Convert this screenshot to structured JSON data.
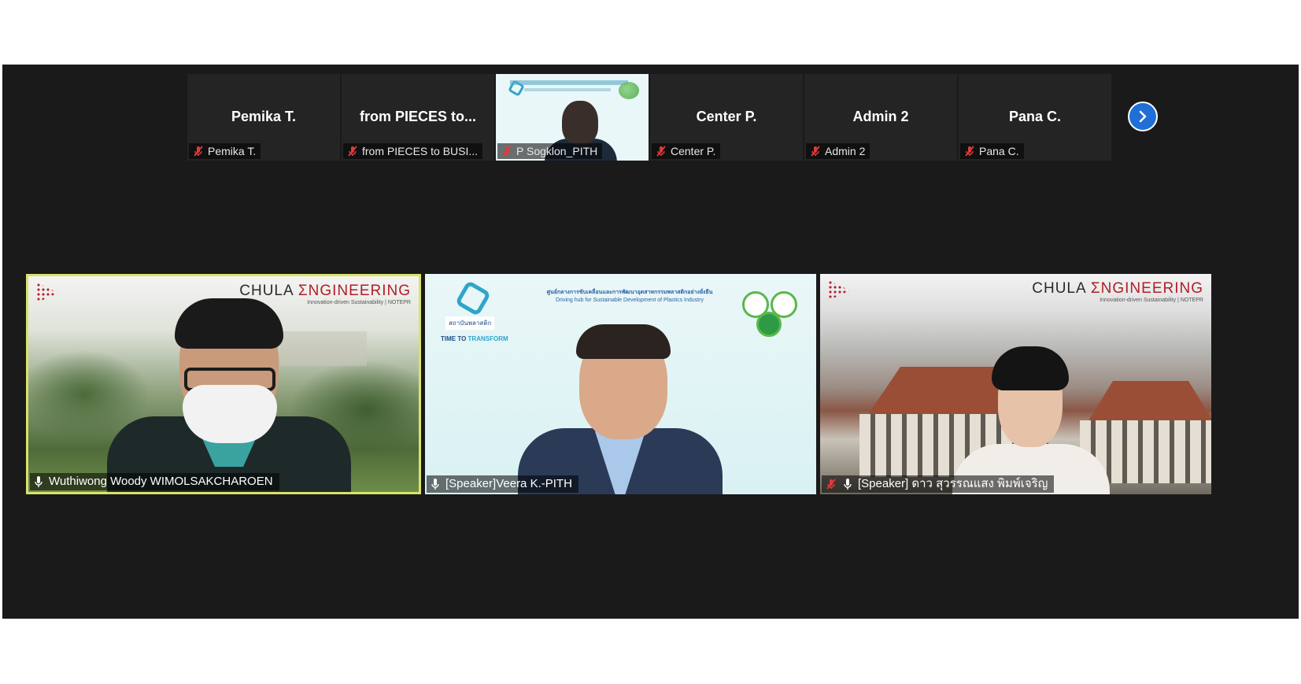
{
  "strip": {
    "thumbs": [
      {
        "title": "Pemika T.",
        "label": "Pemika T."
      },
      {
        "title": "from PIECES to...",
        "label": "from PIECES to BUSI..."
      },
      {
        "title": "",
        "label": "P Sogklon_PITH"
      },
      {
        "title": "Center P.",
        "label": "Center P."
      },
      {
        "title": "Admin 2",
        "label": "Admin 2"
      },
      {
        "title": "Pana C.",
        "label": "Pana C."
      }
    ],
    "next_icon": "chevron-right-icon"
  },
  "tiles": {
    "left": {
      "name": "Wuthiwong Woody WIMOLSAKCHAROEN",
      "brand_a": "CHULA ",
      "brand_b": "ƩNGINEERING",
      "brand_sub": "Innovation-driven Sustainability | NOTEPR",
      "active_speaker_color": "#d8e36a"
    },
    "center": {
      "name": "[Speaker]Veera K.-PITH",
      "slide_title": "ศูนย์กลางการขับเคลื่อนและการพัฒนาอุตสาหกรรมพลาสติกอย่างยั่งยืน",
      "slide_subtitle": "Driving hub for Sustainable Development of Plastics Industry",
      "org_name": "สถาบันพลาสติก",
      "tagline_a": "TIME TO ",
      "tagline_b": "TRANSFORM"
    },
    "right": {
      "name": "[Speaker] ดาว สุวรรณแสง พิมพ์เจริญ",
      "brand_a": "CHULA ",
      "brand_b": "ƩNGINEERING",
      "brand_sub": "Innovation-driven Sustainability | NOTEPR"
    }
  },
  "colors": {
    "meeting_bg": "#1a1a1a",
    "tile_bg": "#242424",
    "muted_red": "#e03a3a",
    "next_button": "#1f6fd6"
  }
}
